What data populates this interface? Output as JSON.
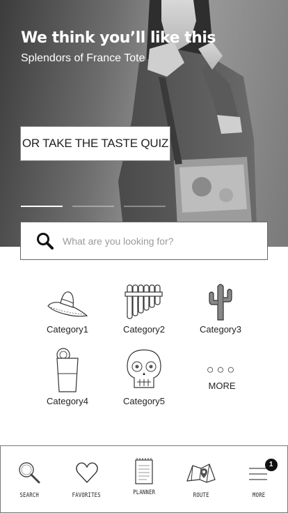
{
  "hero": {
    "title": "We think you’ll like this",
    "subtitle": "Splendors of France Tote",
    "quiz_button": "OR TAKE THE TASTE QUIZ",
    "slides_total": 3,
    "active_slide": 0
  },
  "search": {
    "placeholder": "What are you looking for?"
  },
  "categories": [
    {
      "label": "Category1",
      "icon": "sombrero-icon"
    },
    {
      "label": "Category2",
      "icon": "pan-flute-icon"
    },
    {
      "label": "Category3",
      "icon": "cactus-icon"
    },
    {
      "label": "Category4",
      "icon": "drink-icon"
    },
    {
      "label": "Category5",
      "icon": "sugar-skull-icon"
    },
    {
      "label": "MORE",
      "icon": "more-dots-icon",
      "glyph": "○○○"
    }
  ],
  "tabbar": [
    {
      "label": "SEARCH",
      "icon": "search-icon"
    },
    {
      "label": "FAVORITES",
      "icon": "heart-icon"
    },
    {
      "label": "PLANNER",
      "icon": "notepad-icon"
    },
    {
      "label": "ROUTE",
      "icon": "map-icon"
    },
    {
      "label": "MORE",
      "icon": "menu-icon",
      "badge": "1"
    }
  ],
  "colors": {
    "text": "#222222",
    "border": "#777777",
    "hero_text": "#ffffff",
    "badge_bg": "#111111"
  }
}
